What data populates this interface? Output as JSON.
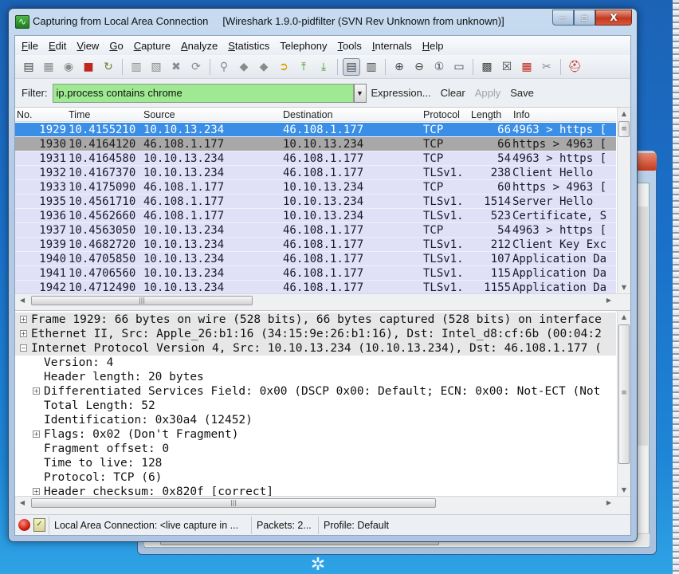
{
  "window": {
    "title": "Capturing from Local Area Connection",
    "subtitle": "[Wireshark 1.9.0-pidfilter  (SVN Rev Unknown from unknown)]",
    "controls": {
      "minimize": "‒",
      "maximize": "▫",
      "close": "X"
    }
  },
  "menu": [
    {
      "label": "File",
      "accel": "F",
      "rest": "ile"
    },
    {
      "label": "Edit",
      "accel": "E",
      "rest": "dit"
    },
    {
      "label": "View",
      "accel": "V",
      "rest": "iew"
    },
    {
      "label": "Go",
      "accel": "G",
      "rest": "o"
    },
    {
      "label": "Capture",
      "accel": "C",
      "rest": "apture"
    },
    {
      "label": "Analyze",
      "accel": "A",
      "rest": "nalyze"
    },
    {
      "label": "Statistics",
      "accel": "S",
      "rest": "tatistics"
    },
    {
      "label": "Telephony",
      "accel": "",
      "rest": "Telephony"
    },
    {
      "label": "Tools",
      "accel": "T",
      "rest": "ools"
    },
    {
      "label": "Internals",
      "accel": "I",
      "rest": "nternals"
    },
    {
      "label": "Help",
      "accel": "H",
      "rest": "elp"
    }
  ],
  "toolbar": {
    "icons": {
      "interfaces": "▤",
      "options": "▦",
      "start": "◉",
      "stop": "■",
      "restart": "↻",
      "open": "▥",
      "save": "▧",
      "close": "✖",
      "reload": "⟳",
      "find": "⚲",
      "back": "◆",
      "forward": "◆",
      "goto": "➲",
      "first": "⤒",
      "last": "⤓",
      "colorize": "▤",
      "autoscroll": "▥",
      "zoom_in": "⊕",
      "zoom_out": "⊖",
      "zoom_normal": "①",
      "resize_columns": "▭",
      "capture_filters": "▩",
      "display_filters": "☒",
      "coloring_rules": "▦",
      "preferences": "✂",
      "help": "⛑"
    }
  },
  "filter": {
    "label": "Filter:",
    "value": "ip.process contains chrome",
    "dropdown_icon": "▼",
    "expression": "Expression...",
    "clear": "Clear",
    "apply": "Apply",
    "save": "Save",
    "valid_color": "#9ee992"
  },
  "packet_list": {
    "columns": [
      "No.",
      "Time",
      "Source",
      "Destination",
      "Protocol",
      "Length",
      "Info"
    ],
    "rows": [
      {
        "no": "1929",
        "time": "10.4155210",
        "src": "10.10.13.234",
        "dst": "46.108.1.177",
        "proto": "TCP",
        "len": "66",
        "info": "4963 > https [",
        "state": "selected"
      },
      {
        "no": "1930",
        "time": "10.4164120",
        "src": "46.108.1.177",
        "dst": "10.10.13.234",
        "proto": "TCP",
        "len": "66",
        "info": "https > 4963 [",
        "state": "marked"
      },
      {
        "no": "1931",
        "time": "10.4164580",
        "src": "10.10.13.234",
        "dst": "46.108.1.177",
        "proto": "TCP",
        "len": "54",
        "info": "4963 > https [",
        "state": "normal"
      },
      {
        "no": "1932",
        "time": "10.4167370",
        "src": "10.10.13.234",
        "dst": "46.108.1.177",
        "proto": "TLSv1.:",
        "len": "238",
        "info": "Client Hello",
        "state": "normal"
      },
      {
        "no": "1933",
        "time": "10.4175090",
        "src": "46.108.1.177",
        "dst": "10.10.13.234",
        "proto": "TCP",
        "len": "60",
        "info": "https > 4963 [",
        "state": "normal"
      },
      {
        "no": "1935",
        "time": "10.4561710",
        "src": "46.108.1.177",
        "dst": "10.10.13.234",
        "proto": "TLSv1.:",
        "len": "1514",
        "info": "Server Hello",
        "state": "normal"
      },
      {
        "no": "1936",
        "time": "10.4562660",
        "src": "46.108.1.177",
        "dst": "10.10.13.234",
        "proto": "TLSv1.:",
        "len": "523",
        "info": "Certificate, S",
        "state": "normal"
      },
      {
        "no": "1937",
        "time": "10.4563050",
        "src": "10.10.13.234",
        "dst": "46.108.1.177",
        "proto": "TCP",
        "len": "54",
        "info": "4963 > https [",
        "state": "normal"
      },
      {
        "no": "1939",
        "time": "10.4682720",
        "src": "10.10.13.234",
        "dst": "46.108.1.177",
        "proto": "TLSv1.:",
        "len": "212",
        "info": "Client Key Exc",
        "state": "normal"
      },
      {
        "no": "1940",
        "time": "10.4705850",
        "src": "10.10.13.234",
        "dst": "46.108.1.177",
        "proto": "TLSv1.:",
        "len": "107",
        "info": "Application Da",
        "state": "normal"
      },
      {
        "no": "1941",
        "time": "10.4706560",
        "src": "10.10.13.234",
        "dst": "46.108.1.177",
        "proto": "TLSv1.:",
        "len": "115",
        "info": "Application Da",
        "state": "normal"
      },
      {
        "no": "1942",
        "time": "10.4712490",
        "src": "10.10.13.234",
        "dst": "46.108.1.177",
        "proto": "TLSv1.:",
        "len": "1155",
        "info": "Application Da",
        "state": "normal"
      }
    ]
  },
  "details": {
    "rows": [
      {
        "level": 0,
        "toggle": "⊞",
        "text": "Frame 1929: 66 bytes on wire (528 bits), 66 bytes captured (528 bits) on interface"
      },
      {
        "level": 0,
        "toggle": "⊞",
        "text": "Ethernet II, Src: Apple_26:b1:16 (34:15:9e:26:b1:16), Dst: Intel_d8:cf:6b (00:04:2"
      },
      {
        "level": 0,
        "toggle": "⊟",
        "text": "Internet Protocol Version 4, Src: 10.10.13.234 (10.10.13.234), Dst: 46.108.1.177 ("
      },
      {
        "level": 1,
        "toggle": "",
        "text": "Version: 4"
      },
      {
        "level": 1,
        "toggle": "",
        "text": "Header length: 20 bytes"
      },
      {
        "level": 1,
        "toggle": "⊞",
        "text": "Differentiated Services Field: 0x00 (DSCP 0x00: Default; ECN: 0x00: Not-ECT (Not"
      },
      {
        "level": 1,
        "toggle": "",
        "text": "Total Length: 52"
      },
      {
        "level": 1,
        "toggle": "",
        "text": "Identification: 0x30a4 (12452)"
      },
      {
        "level": 1,
        "toggle": "⊞",
        "text": "Flags: 0x02 (Don't Fragment)"
      },
      {
        "level": 1,
        "toggle": "",
        "text": "Fragment offset: 0"
      },
      {
        "level": 1,
        "toggle": "",
        "text": "Time to live: 128"
      },
      {
        "level": 1,
        "toggle": "",
        "text": "Protocol: TCP (6)"
      },
      {
        "level": 1,
        "toggle": "⊞",
        "text": "Header checksum: 0x820f [correct]"
      }
    ]
  },
  "scroll": {
    "up": "▲",
    "down": "▼",
    "left": "◀",
    "right": "▶",
    "grip": "≡",
    "hgrip": "|||"
  },
  "statusbar": {
    "capture_status": "Local Area Connection: <live capture in ...",
    "packets": "Packets: 2...",
    "profile": "Profile: Default",
    "expert_icon": "✓"
  },
  "desktop": {
    "start_glyph": "✲"
  }
}
